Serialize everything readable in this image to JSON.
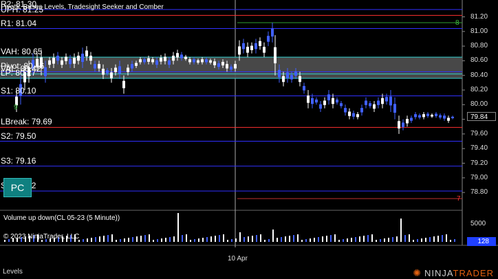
{
  "indicator_title": "Pivots, Bases Levels, Tradesight Seeker and Comber",
  "levels": [
    {
      "label": "R2: 81.30",
      "value": 81.3,
      "color": "#3030ff"
    },
    {
      "label": "UPH: 81.25",
      "value": 81.22,
      "color": "#ff3030"
    },
    {
      "label": "R1: 81.04",
      "value": 81.04,
      "color": "#3030ff"
    },
    {
      "label": "VAH: 80.65",
      "value": 80.65,
      "color": "#30d0d0"
    },
    {
      "label": "Pivot: 80.46",
      "value": 80.45,
      "color": "#3030ff"
    },
    {
      "label": "VAL: 80.42",
      "value": 80.42,
      "color": "#30d0d0"
    },
    {
      "label": "LP: 80.27",
      "value": 80.36,
      "color": "#30d0d0"
    },
    {
      "label": "S1: 80.10",
      "value": 80.12,
      "color": "#3030ff"
    },
    {
      "label": "LBreak: 79.69",
      "value": 79.69,
      "color": "#ff3030"
    },
    {
      "label": "S2: 79.50",
      "value": 79.5,
      "color": "#3030ff"
    },
    {
      "label": "S3: 79.16",
      "value": 79.16,
      "color": "#3030ff"
    },
    {
      "label": "S4: 78.82",
      "value": 78.82,
      "color": "#3030ff"
    }
  ],
  "price_axis": {
    "ticks": [
      "81.20",
      "81.00",
      "80.80",
      "80.60",
      "80.40",
      "80.20",
      "80.00",
      "79.80",
      "79.60",
      "79.40",
      "79.20",
      "79.00",
      "78.80"
    ],
    "last_price": "79.84"
  },
  "markers": {
    "seeker_count": "8",
    "comber_count": "7",
    "left_marker": "9"
  },
  "pc_button": "PC",
  "volume_panel": {
    "title": "Volume up down(CL 05-23 (5 Minute))",
    "axis_tick": "5000",
    "last_volume": "128",
    "copyright": "© 2023 NinjaTrader, LLC"
  },
  "date_label": "10 Apr",
  "footer_tab": "Levels",
  "brand": {
    "ninja": "NINJA",
    "trader": "TRADER",
    "accent": "#e06010"
  },
  "colors": {
    "value_area": "#505050",
    "up_bar": "#ffffff",
    "down_bar": "#4060ff"
  }
}
